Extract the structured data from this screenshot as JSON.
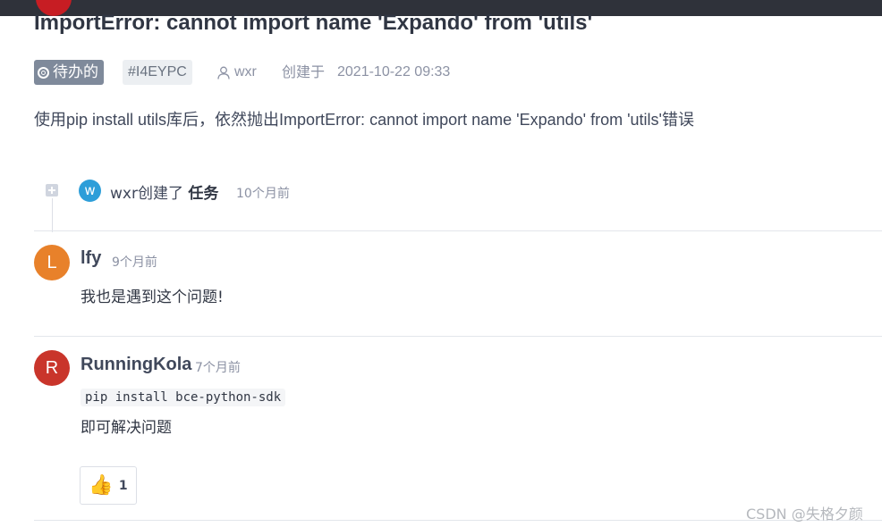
{
  "issue": {
    "title": "ImportError: cannot import name 'Expando' from 'utils'",
    "status": "待办的",
    "id": "#I4EYPC",
    "author": "wxr",
    "created_label": "创建于",
    "created_time": "2021-10-22 09:33",
    "description": "使用pip install utils库后，依然抛出ImportError: cannot import name 'Expando' from 'utils'错误"
  },
  "timeline_event": {
    "avatar_letter": "w",
    "text_prefix": "wxr创建了",
    "text_bold": "任务",
    "time": "10个月前"
  },
  "comments": [
    {
      "avatar_letter": "L",
      "avatar_color": "#e8812a",
      "name": "lfy",
      "time": "9个月前",
      "body": "我也是遇到这个问题!"
    },
    {
      "avatar_letter": "R",
      "avatar_color": "#c9352b",
      "name": "RunningKola",
      "time": "7个月前",
      "code": "pip install bce-python-sdk",
      "body": "即可解决问题",
      "reaction": {
        "icon": "thumbs-up",
        "count": "1"
      }
    }
  ],
  "watermark": "CSDN @失格夕颜"
}
